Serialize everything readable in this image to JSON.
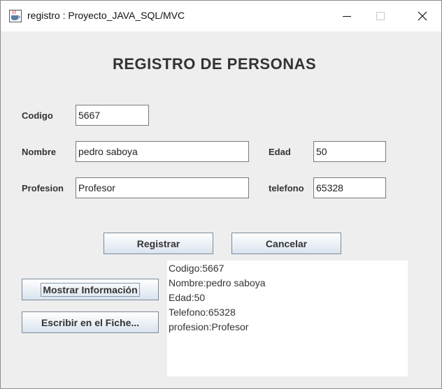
{
  "window": {
    "title": "registro : Proyecto_JAVA_SQL/MVC",
    "icon": "java-coffee-cup-icon"
  },
  "form": {
    "heading": "REGISTRO DE PERSONAS",
    "codigo": {
      "label": "Codigo",
      "value": "5667"
    },
    "nombre": {
      "label": "Nombre",
      "value": "pedro saboya"
    },
    "edad": {
      "label": "Edad",
      "value": "50"
    },
    "profesion": {
      "label": "Profesion",
      "value": "Profesor"
    },
    "telefono": {
      "label": "telefono",
      "value": "65328"
    }
  },
  "buttons": {
    "registrar": "Registrar",
    "cancelar": "Cancelar",
    "mostrar": "Mostrar Información",
    "escribir": "Escribir en el Fiche..."
  },
  "output": {
    "lines": [
      "Codigo:5667",
      "Nombre:pedro saboya",
      "Edad:50",
      "Telefono:65328",
      "profesion:Profesor"
    ]
  }
}
